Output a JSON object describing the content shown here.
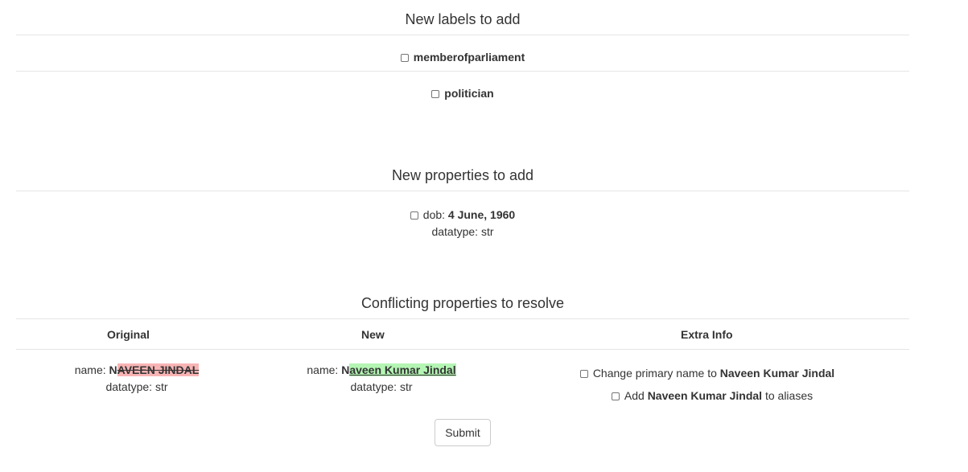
{
  "labels_section": {
    "title": "New labels to add",
    "items": [
      {
        "label": "memberofparliament"
      },
      {
        "label": "politician"
      }
    ]
  },
  "properties_section": {
    "title": "New properties to add",
    "items": [
      {
        "key": "dob: ",
        "value": "4 June, 1960",
        "datatype_text": "datatype: str"
      }
    ]
  },
  "conflicts_section": {
    "title": "Conflicting properties to resolve",
    "columns": [
      "Original",
      "New",
      "Extra Info"
    ],
    "rows": [
      {
        "original": {
          "key": "name: ",
          "common_prefix": "N",
          "removed": "AVEEN JINDAL",
          "datatype_text": "datatype: str"
        },
        "new": {
          "key": "name: ",
          "common_prefix": "N",
          "added": "aveen Kumar Jindal",
          "datatype_text": "datatype: str"
        },
        "extra": {
          "change_primary_prefix": "Change primary name to ",
          "change_primary_name": "Naveen Kumar Jindal",
          "aliases_prefix": "Add ",
          "aliases_name": "Naveen Kumar Jindal",
          "aliases_suffix": " to aliases"
        }
      }
    ]
  },
  "submit": {
    "label": "Submit"
  }
}
